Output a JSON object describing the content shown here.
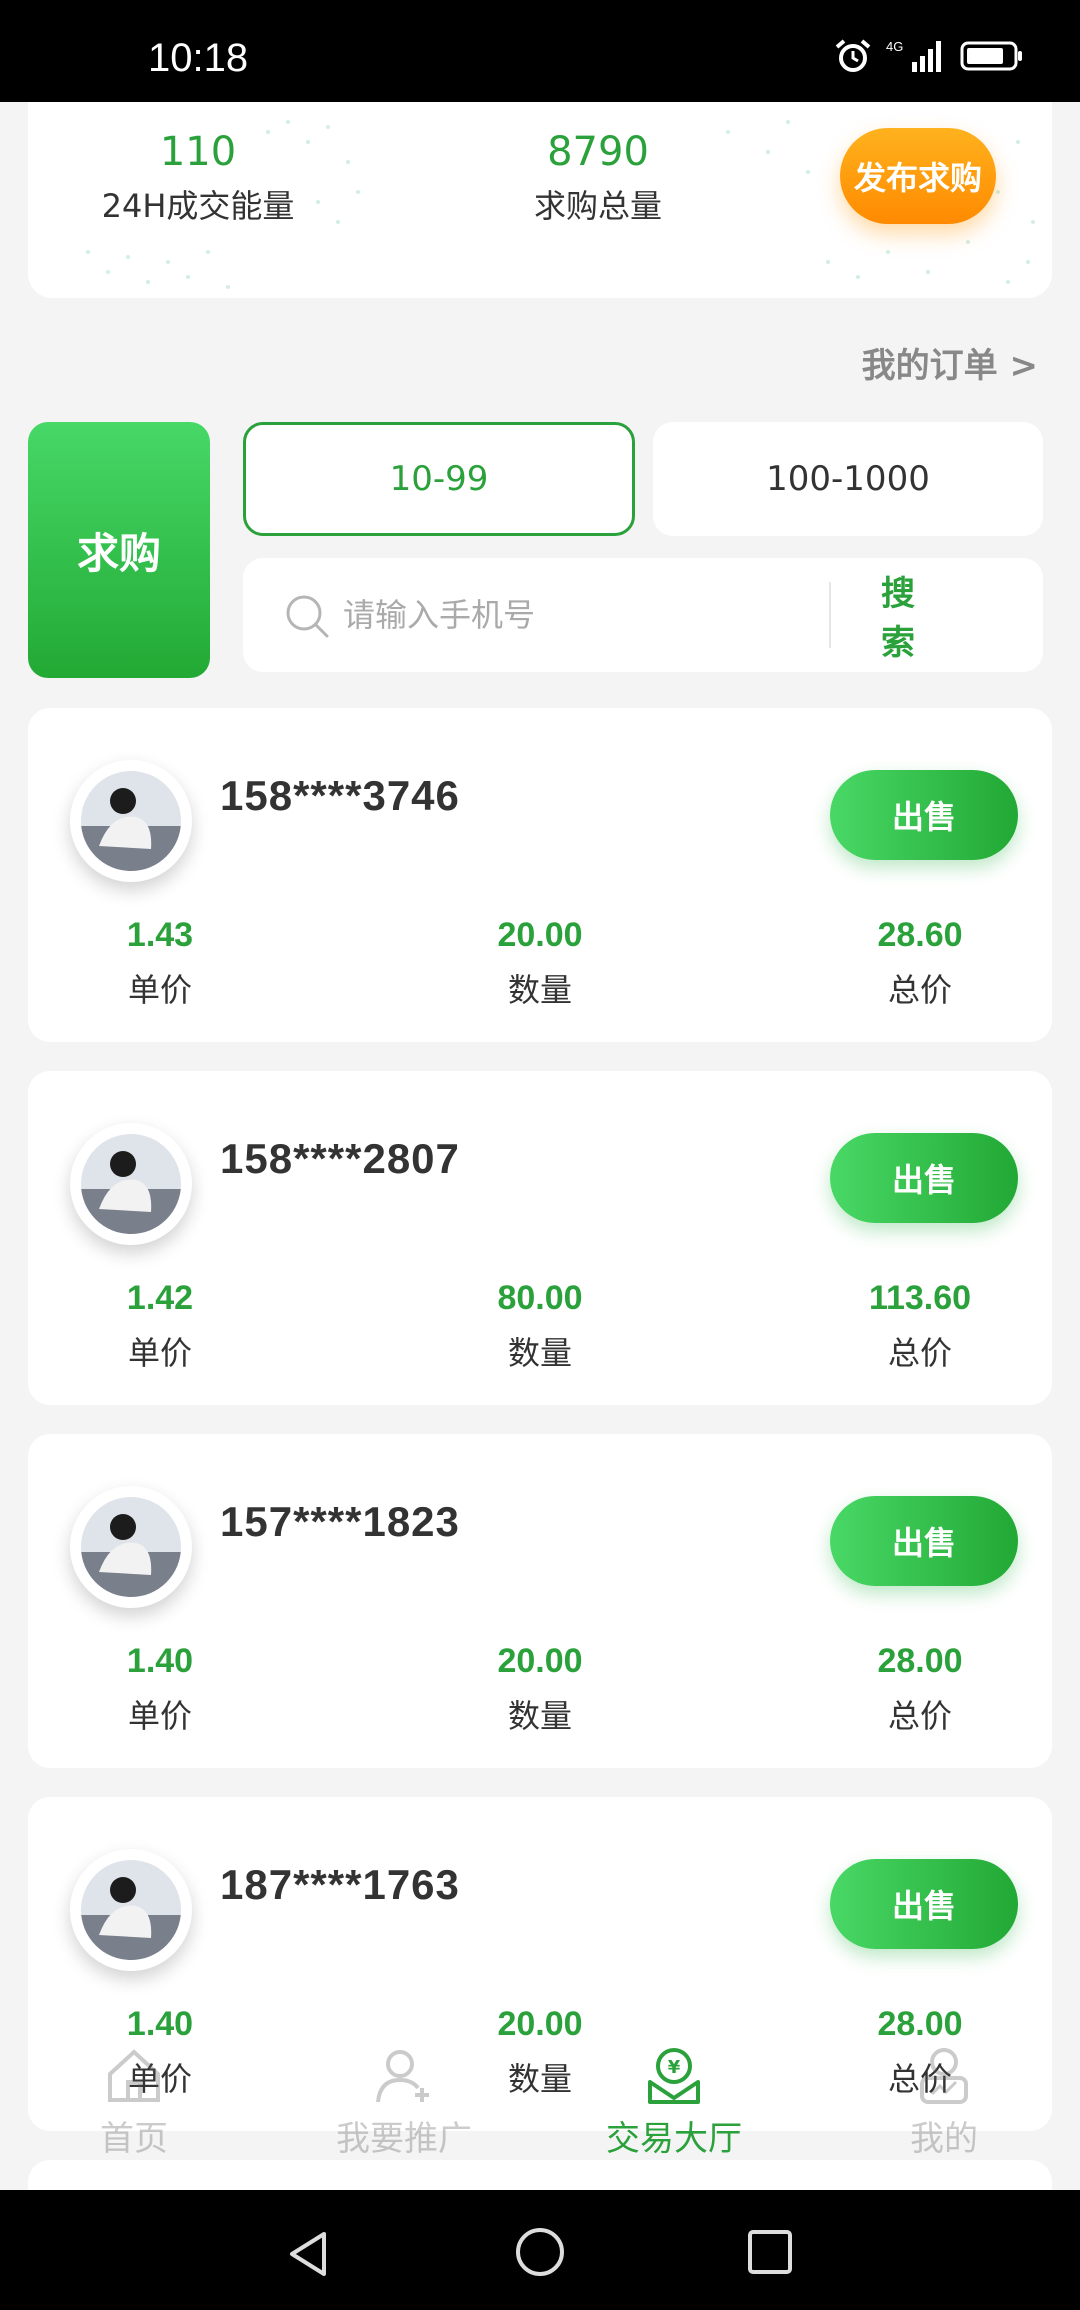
{
  "status_bar": {
    "time": "10:18",
    "network": "4G"
  },
  "stats": {
    "volume_value": "110",
    "volume_label": "24H成交能量",
    "total_value": "8790",
    "total_label": "求购总量",
    "publish_label": "发布求购"
  },
  "my_orders_label": "我的订单 >",
  "filter": {
    "buy_tab_label": "求购",
    "ranges": [
      "10-99",
      "100-1000"
    ],
    "selected_range": "10-99"
  },
  "search": {
    "placeholder": "请输入手机号",
    "button_label": "搜  索"
  },
  "orders": [
    {
      "phone": "158****3746",
      "sell_label": "出售",
      "price": "1.43",
      "price_label": "单价",
      "quantity": "20.00",
      "quantity_label": "数量",
      "total": "28.60",
      "total_label": "总价"
    },
    {
      "phone": "158****2807",
      "sell_label": "出售",
      "price": "1.42",
      "price_label": "单价",
      "quantity": "80.00",
      "quantity_label": "数量",
      "total": "113.60",
      "total_label": "总价"
    },
    {
      "phone": "157****1823",
      "sell_label": "出售",
      "price": "1.40",
      "price_label": "单价",
      "quantity": "20.00",
      "quantity_label": "数量",
      "total": "28.00",
      "total_label": "总价"
    },
    {
      "phone": "187****1763",
      "sell_label": "出售",
      "price": "1.40",
      "price_label": "单价",
      "quantity": "20.00",
      "quantity_label": "数量",
      "total": "28.00",
      "total_label": "总价"
    }
  ],
  "tabbar": {
    "items": [
      {
        "label": "首页",
        "icon": "home-icon",
        "active": false
      },
      {
        "label": "我要推广",
        "icon": "user-add-icon",
        "active": false
      },
      {
        "label": "交易大厅",
        "icon": "trade-hall-icon",
        "active": true
      },
      {
        "label": "我的",
        "icon": "profile-icon",
        "active": false
      }
    ]
  },
  "colors": {
    "accent": "#2aa13a",
    "orange": "#ff9a0a",
    "background": "#f4f4f4"
  }
}
